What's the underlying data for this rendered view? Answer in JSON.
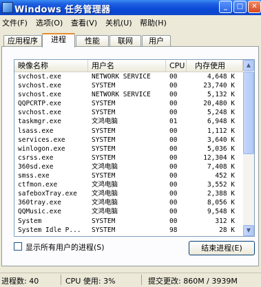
{
  "window": {
    "title": "Windows 任务管理器"
  },
  "menu": {
    "items": [
      "文件(F)",
      "选项(O)",
      "查看(V)",
      "关机(U)",
      "帮助(H)"
    ]
  },
  "tabs": [
    {
      "label": "应用程序",
      "active": false
    },
    {
      "label": "进程",
      "active": true
    },
    {
      "label": "性能",
      "active": false
    },
    {
      "label": "联网",
      "active": false
    },
    {
      "label": "用户",
      "active": false
    }
  ],
  "columns": {
    "name": "映像名称",
    "user": "用户名",
    "cpu": "CPU",
    "mem": "内存使用"
  },
  "processes": [
    {
      "name": "svchost.exe",
      "user": "NETWORK SERVICE",
      "cpu": "00",
      "mem": "4,648 K"
    },
    {
      "name": "svchost.exe",
      "user": "SYSTEM",
      "cpu": "00",
      "mem": "23,740 K"
    },
    {
      "name": "svchost.exe",
      "user": "NETWORK SERVICE",
      "cpu": "00",
      "mem": "5,132 K"
    },
    {
      "name": "QQPCRTP.exe",
      "user": "SYSTEM",
      "cpu": "00",
      "mem": "20,480 K"
    },
    {
      "name": "svchost.exe",
      "user": "SYSTEM",
      "cpu": "00",
      "mem": "5,248 K"
    },
    {
      "name": "taskmgr.exe",
      "user": "文鸿电脑",
      "cpu": "01",
      "mem": "6,948 K"
    },
    {
      "name": "lsass.exe",
      "user": "SYSTEM",
      "cpu": "00",
      "mem": "1,112 K"
    },
    {
      "name": "services.exe",
      "user": "SYSTEM",
      "cpu": "00",
      "mem": "3,640 K"
    },
    {
      "name": "winlogon.exe",
      "user": "SYSTEM",
      "cpu": "00",
      "mem": "5,036 K"
    },
    {
      "name": "csrss.exe",
      "user": "SYSTEM",
      "cpu": "00",
      "mem": "12,304 K"
    },
    {
      "name": "360sd.exe",
      "user": "文鸿电脑",
      "cpu": "00",
      "mem": "7,408 K"
    },
    {
      "name": "smss.exe",
      "user": "SYSTEM",
      "cpu": "00",
      "mem": "452 K"
    },
    {
      "name": "ctfmon.exe",
      "user": "文鸿电脑",
      "cpu": "00",
      "mem": "3,552 K"
    },
    {
      "name": "safeboxTray.exe",
      "user": "文鸿电脑",
      "cpu": "00",
      "mem": "2,388 K"
    },
    {
      "name": "360tray.exe",
      "user": "文鸿电脑",
      "cpu": "00",
      "mem": "8,056 K"
    },
    {
      "name": "QQMusic.exe",
      "user": "文鸿电脑",
      "cpu": "00",
      "mem": "9,548 K"
    },
    {
      "name": "System",
      "user": "SYSTEM",
      "cpu": "00",
      "mem": "312 K"
    },
    {
      "name": "System Idle P...",
      "user": "SYSTEM",
      "cpu": "98",
      "mem": "28 K"
    }
  ],
  "show_all_users": {
    "label": "显示所有用户的进程(S)",
    "checked": false
  },
  "end_process_label": "结束进程(E)",
  "status": {
    "processes": "进程数: 40",
    "cpu": "CPU 使用: 3%",
    "commit": "提交更改: 860M / 3939M"
  },
  "icons": {
    "app": "task-manager-icon",
    "minimize": "minimize-icon",
    "maximize": "maximize-icon",
    "close": "close-icon"
  },
  "colors": {
    "titlebar": "#0a4ad8",
    "tab_highlight": "#e68b2c",
    "chrome": "#ece9d8"
  }
}
